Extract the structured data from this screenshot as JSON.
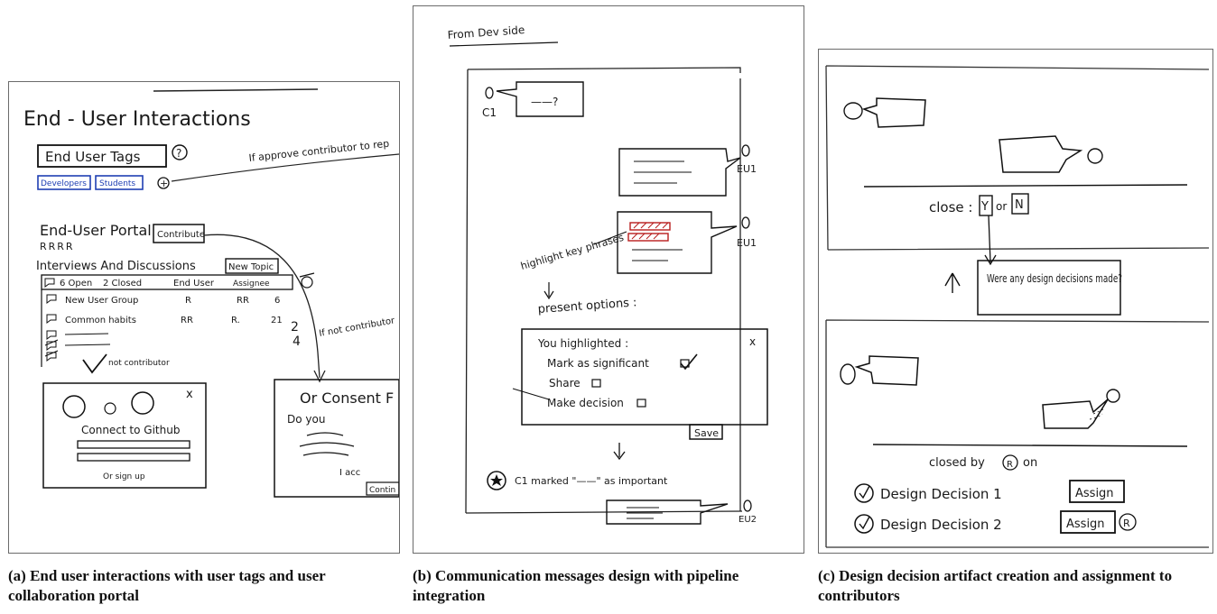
{
  "panel_a": {
    "title": "End - User Interactions",
    "tags_box": "End User Tags",
    "help_mark": "?",
    "approve_note": "If approve contributor to rep",
    "tag_developers": "Developers",
    "tag_students": "Students",
    "plus": "+",
    "portal_title": "End-User Portal",
    "portal_avatars": "RRRR",
    "contribute_button": "Contribute",
    "section_title": "Interviews And Discussions",
    "new_topic_button": "New Topic",
    "table_header": {
      "open": "6 Open",
      "closed": "2 Closed",
      "end_user": "End User",
      "assignee": "Assignee"
    },
    "rows": [
      {
        "title": "New User Group",
        "end_user": "R",
        "assignee": "RR",
        "count": "6"
      },
      {
        "title": "Common habits",
        "end_user": "RR",
        "assignee": "R.",
        "count": "21"
      }
    ],
    "side_numbers": [
      "2",
      "4"
    ],
    "if_not_contributor": "If not contributor",
    "not_contributor": "not contributor",
    "github_close": "x",
    "github_button": "Connect to Github",
    "sign_up": "Or sign up",
    "consent_title": "Or Consent F",
    "consent_do_you": "Do you",
    "consent_accept": "I acc",
    "consent_button": "Contin"
  },
  "panel_b": {
    "header": "From Dev side",
    "c1_label": "C1",
    "c1_bubble": "——?",
    "eu1_label": "EU1",
    "eu1_label_2": "EU1",
    "highlight_note": "highlight key phrases",
    "present_options": "present options :",
    "dialog_title": "You highlighted :",
    "dialog_close": "x",
    "options": [
      {
        "label": "Mark as significant",
        "checked": true
      },
      {
        "label": "Share",
        "checked": false
      },
      {
        "label": "Make decision",
        "checked": false
      }
    ],
    "save_button": "Save",
    "marked_text": "C1 marked \"——\" as important",
    "eu2_label": "EU2"
  },
  "panel_c": {
    "close_label": "close :",
    "close_yes": "Y",
    "close_or": "or",
    "close_no": "N",
    "question": "Were any design decisions made?",
    "closed_by": "closed by",
    "closed_on": "on",
    "decisions": [
      {
        "label": "Design Decision 1",
        "button": "Assign",
        "assignee": ""
      },
      {
        "label": "Design Decision 2",
        "button": "Assign",
        "assignee": "R"
      }
    ]
  },
  "captions": {
    "a": "(a) End user interactions with user tags and user collaboration portal",
    "b": "(b) Communication messages design with pipeline integration",
    "c": "(c) Design decision artifact creation and assignment to contributors"
  }
}
